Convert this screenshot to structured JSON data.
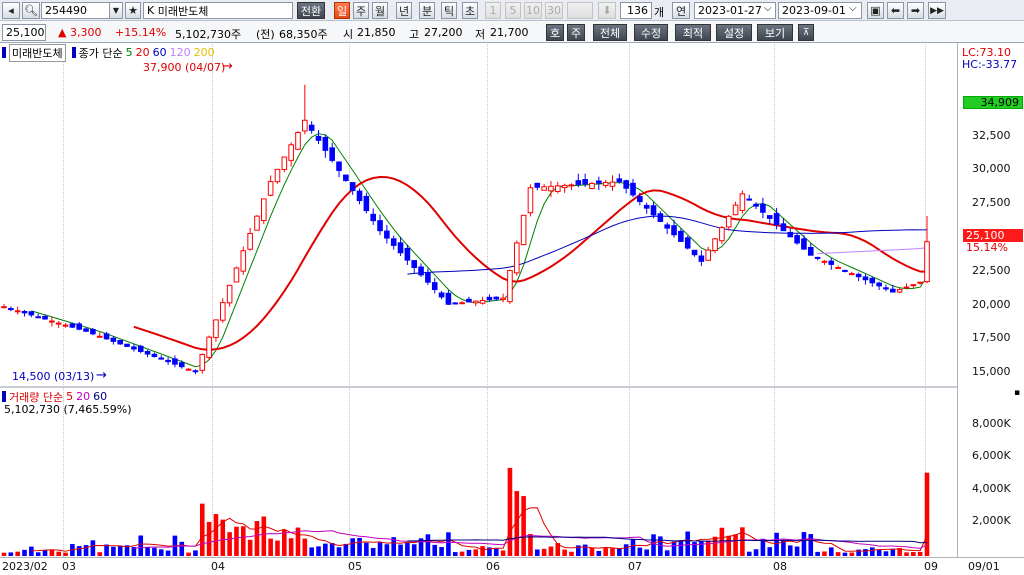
{
  "toolbar": {
    "code": "254490",
    "etf_prefix": "K",
    "name": "미래반도체",
    "buttons": [
      "전환",
      "일",
      "주",
      "월",
      "년",
      "분",
      "틱",
      "초",
      "1",
      "5",
      "10",
      "30"
    ],
    "count": "136",
    "count_unit": "개",
    "year_btn": "연",
    "date_from": "2023-01-27",
    "date_to": "2023-09-01"
  },
  "quote": {
    "price": "25,100",
    "change": "▲ 3,300",
    "change_pct": "+15.14%",
    "volume": "5,102,730주",
    "prev_label": "(전)",
    "prev_volume": "68,350주",
    "open_label": "시",
    "open": "21,850",
    "high_label": "고",
    "high": "27,200",
    "low_label": "저",
    "low": "21,700",
    "menu": [
      "호",
      "주",
      "전체",
      "수정",
      "최적",
      "설정",
      "보기"
    ]
  },
  "price_panel": {
    "stock_label": "미래반도체",
    "ma_title": "종가 단순",
    "ma_periods": [
      "5",
      "20",
      "60",
      "120",
      "200"
    ],
    "ma_colors": [
      "#008000",
      "#e00000",
      "#0000c0",
      "#c080ff",
      "#e0c000"
    ],
    "high_annotation": "37,900 (04/07)",
    "low_annotation": "14,500 (03/13)",
    "lc": "LC:73.10",
    "hc": "HC:-33.77",
    "green_tag": "34,909",
    "last_tag": "25,100",
    "last_pct": "15.14%",
    "y_ticks": [
      "32,500",
      "30,000",
      "27,500",
      "25,000",
      "22,500",
      "20,000",
      "17,500",
      "15,000"
    ]
  },
  "volume_panel": {
    "title": "거래량 단순",
    "ma_periods": [
      "5",
      "20",
      "60"
    ],
    "volume_value": "5,102,730 (7,465.59%)",
    "y_ticks": [
      "8,000K",
      "6,000K",
      "4,000K",
      "2,000K"
    ]
  },
  "x_labels": [
    "2023/02",
    "03",
    "04",
    "05",
    "06",
    "07",
    "08",
    "09",
    "09/01"
  ],
  "chart_data": {
    "type": "candlestick",
    "title": "미래반도체",
    "date_range": [
      "2023-01-27",
      "2023-09-01"
    ],
    "count": 136,
    "ohlc_close_samples": [
      {
        "x": "2023-01-27",
        "close": 19800
      },
      {
        "x": "2023-02-15",
        "close": 17800
      },
      {
        "x": "2023-03-13",
        "close": 14500,
        "note": "low"
      },
      {
        "x": "2023-03-31",
        "close": 30000
      },
      {
        "x": "2023-04-07",
        "close": 35000,
        "high": 37900
      },
      {
        "x": "2023-04-26",
        "close": 26000
      },
      {
        "x": "2023-05-12",
        "close": 20000
      },
      {
        "x": "2023-05-24",
        "close": 20500
      },
      {
        "x": "2023-05-30",
        "close": 29500
      },
      {
        "x": "2023-06-20",
        "close": 30000
      },
      {
        "x": "2023-07-10",
        "close": 23500
      },
      {
        "x": "2023-07-20",
        "close": 29000
      },
      {
        "x": "2023-08-04",
        "close": 24000
      },
      {
        "x": "2023-08-24",
        "close": 21000
      },
      {
        "x": "2023-08-31",
        "close": 21800
      },
      {
        "x": "2023-09-01",
        "open": 21850,
        "high": 27200,
        "low": 21700,
        "close": 25100
      }
    ],
    "ma_series": [
      {
        "name": "5",
        "color": "#008000"
      },
      {
        "name": "20",
        "color": "#e00000"
      },
      {
        "name": "60",
        "color": "#0000c0"
      },
      {
        "name": "120",
        "color": "#c080ff"
      }
    ],
    "y_range": [
      13500,
      36000
    ],
    "volume_ylim": [
      0,
      9800000
    ],
    "last_volume": 5102730
  }
}
